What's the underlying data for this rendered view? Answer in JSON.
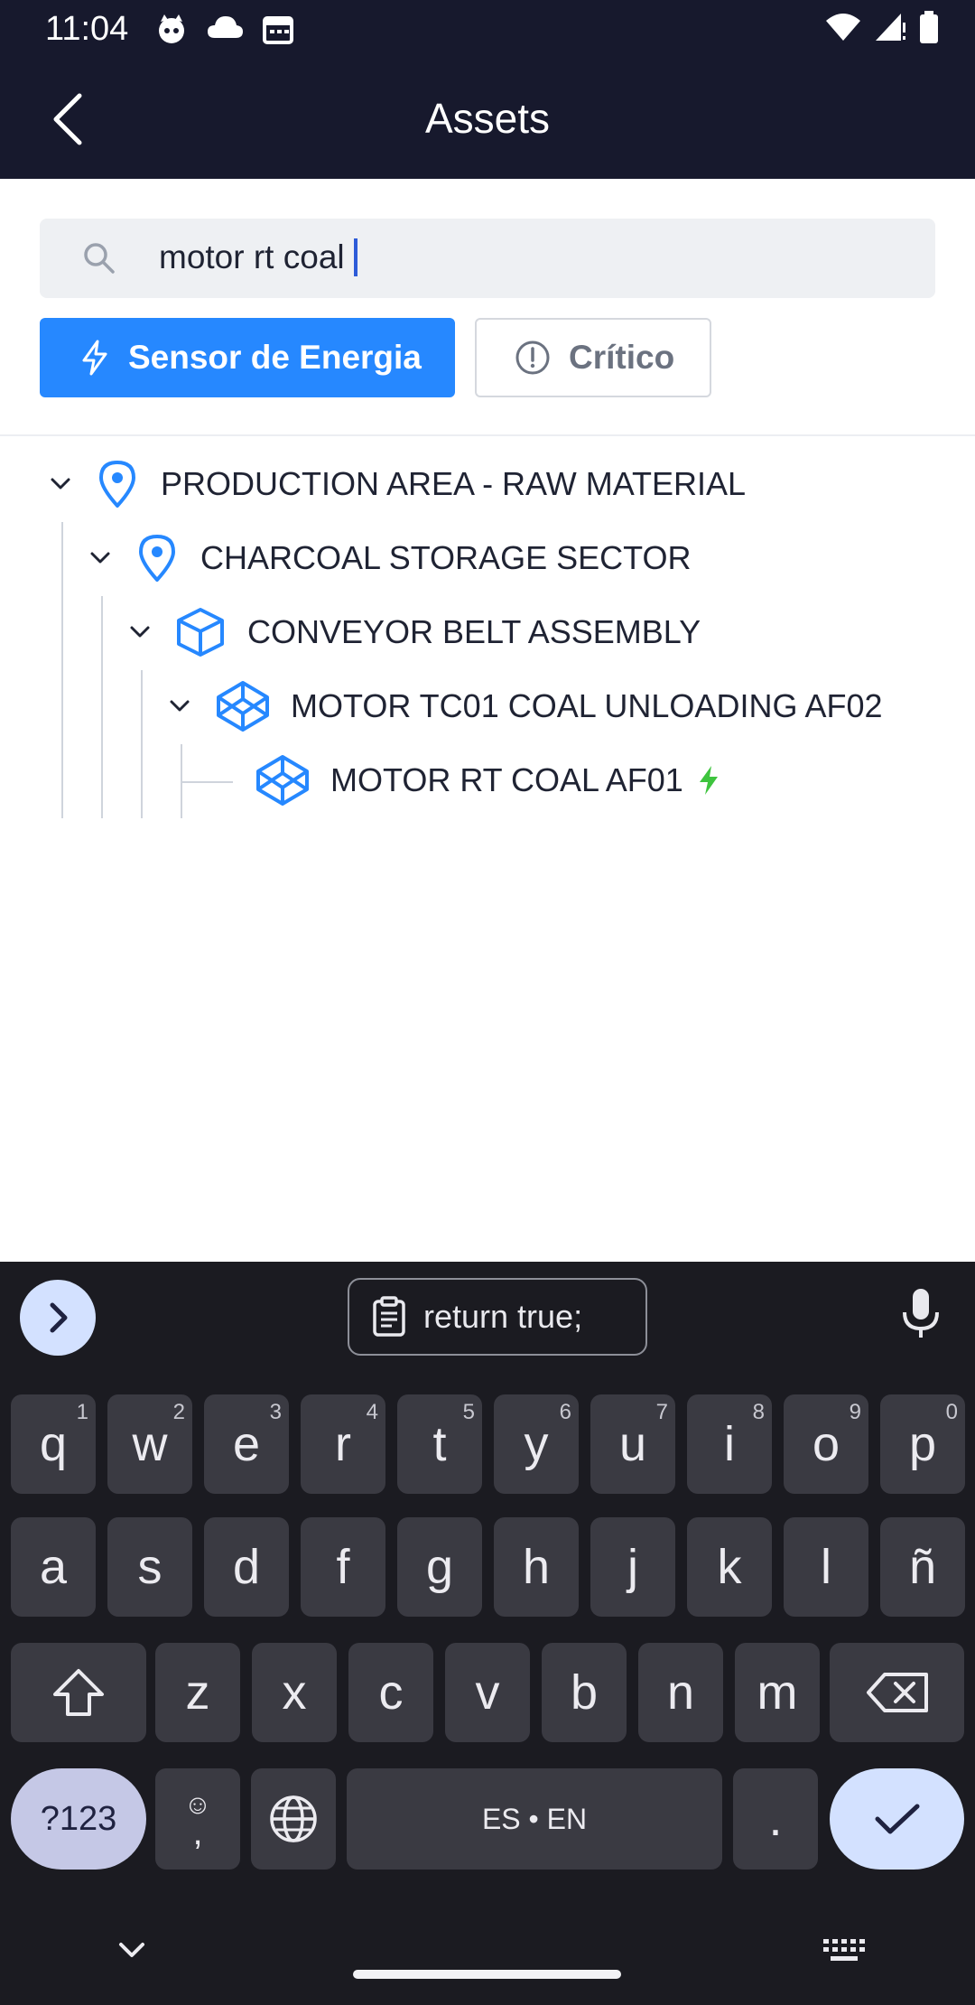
{
  "status_bar": {
    "time": "11:04"
  },
  "app_bar": {
    "title": "Assets"
  },
  "search": {
    "value": "motor rt coal",
    "placeholder": ""
  },
  "filters": [
    {
      "label": "Sensor de Energia",
      "active": true
    },
    {
      "label": "Crítico",
      "active": false
    }
  ],
  "tree": [
    {
      "label": "PRODUCTION AREA - RAW MATERIAL",
      "type": "location",
      "expanded": true,
      "level": 0
    },
    {
      "label": "CHARCOAL STORAGE SECTOR",
      "type": "location",
      "expanded": true,
      "level": 1
    },
    {
      "label": "CONVEYOR BELT ASSEMBLY",
      "type": "asset",
      "expanded": true,
      "level": 2
    },
    {
      "label": "MOTOR TC01 COAL UNLOADING AF02",
      "type": "component",
      "expanded": true,
      "level": 3
    },
    {
      "label": "MOTOR RT COAL AF01",
      "type": "component",
      "expanded": false,
      "level": 4,
      "status": "energy-sensor"
    }
  ],
  "keyboard": {
    "clipboard_suggestion": "return true;",
    "row1": [
      {
        "k": "q",
        "h": "1"
      },
      {
        "k": "w",
        "h": "2"
      },
      {
        "k": "e",
        "h": "3"
      },
      {
        "k": "r",
        "h": "4"
      },
      {
        "k": "t",
        "h": "5"
      },
      {
        "k": "y",
        "h": "6"
      },
      {
        "k": "u",
        "h": "7"
      },
      {
        "k": "i",
        "h": "8"
      },
      {
        "k": "o",
        "h": "9"
      },
      {
        "k": "p",
        "h": "0"
      }
    ],
    "row2": [
      "a",
      "s",
      "d",
      "f",
      "g",
      "h",
      "j",
      "k",
      "l",
      "ñ"
    ],
    "row3": [
      "z",
      "x",
      "c",
      "v",
      "b",
      "n",
      "m"
    ],
    "symbols_label": "?123",
    "comma_label": ",",
    "space_label": "ES • EN",
    "period_label": "."
  },
  "colors": {
    "header_bg": "#17192d",
    "primary": "#2688ff",
    "energy_green": "#3ec43e",
    "keyboard_bg": "#1b1b21"
  }
}
